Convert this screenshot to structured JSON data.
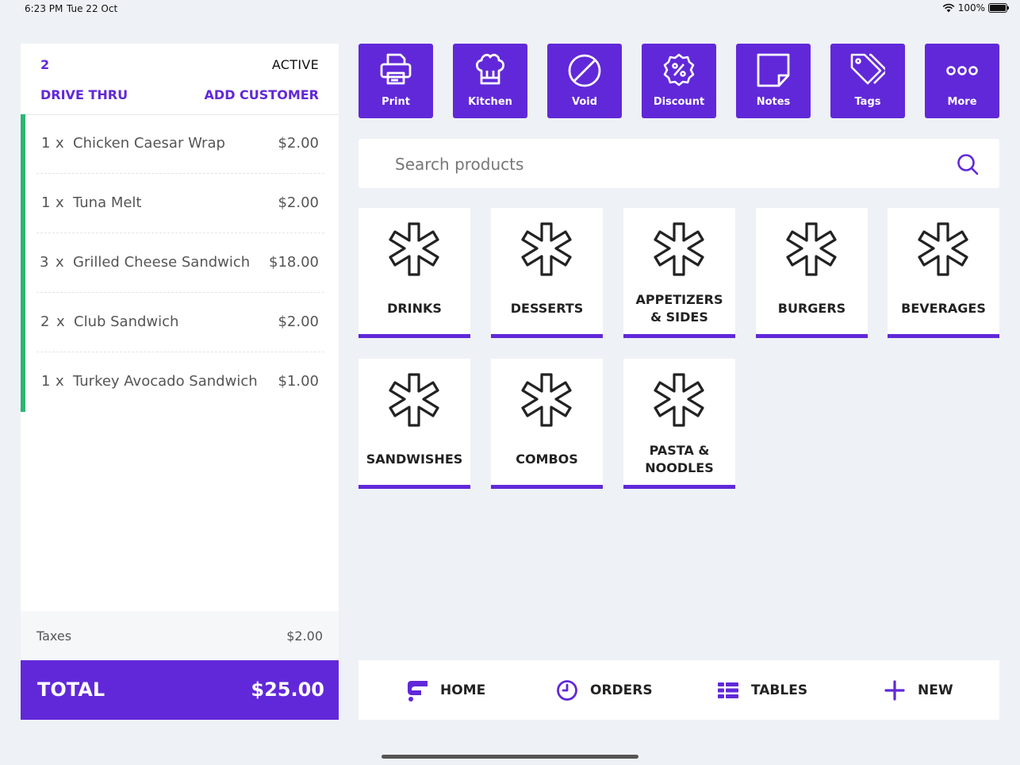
{
  "status_bar": {
    "time": "6:23 PM",
    "date": "Tue 22 Oct",
    "battery": "100%",
    "battery_level": 1.0
  },
  "order": {
    "number": "2",
    "status": "ACTIVE",
    "type": "DRIVE THRU",
    "add_customer_label": "ADD CUSTOMER",
    "items": [
      {
        "qty": "1",
        "x": "x",
        "name": "Chicken Caesar Wrap",
        "price": "$2.00"
      },
      {
        "qty": "1",
        "x": "x",
        "name": "Tuna Melt",
        "price": "$2.00"
      },
      {
        "qty": "3",
        "x": "x",
        "name": "Grilled Cheese Sandwich",
        "price": "$18.00"
      },
      {
        "qty": "2",
        "x": "x",
        "name": "Club Sandwich",
        "price": "$2.00"
      },
      {
        "qty": "1",
        "x": "x",
        "name": "Turkey Avocado Sandwich",
        "price": "$1.00"
      }
    ],
    "taxes_label": "Taxes",
    "taxes_value": "$2.00",
    "total_label": "TOTAL",
    "total_value": "$25.00"
  },
  "actions": [
    {
      "label": "Print",
      "icon": "printer-icon"
    },
    {
      "label": "Kitchen",
      "icon": "chef-hat-icon"
    },
    {
      "label": "Void",
      "icon": "void-icon"
    },
    {
      "label": "Discount",
      "icon": "discount-icon"
    },
    {
      "label": "Notes",
      "icon": "note-icon"
    },
    {
      "label": "Tags",
      "icon": "tags-icon"
    },
    {
      "label": "More",
      "icon": "more-icon"
    }
  ],
  "search": {
    "placeholder": "Search products",
    "icon": "search-icon"
  },
  "categories": [
    {
      "label": "DRINKS",
      "icon": "asterisk-icon"
    },
    {
      "label": "DESSERTS",
      "icon": "asterisk-icon"
    },
    {
      "label": "APPETIZERS & SIDES",
      "icon": "asterisk-icon"
    },
    {
      "label": "BURGERS",
      "icon": "asterisk-icon"
    },
    {
      "label": "BEVERAGES",
      "icon": "asterisk-icon"
    },
    {
      "label": "SANDWISHES",
      "icon": "asterisk-icon"
    },
    {
      "label": "COMBOS",
      "icon": "asterisk-icon"
    },
    {
      "label": "PASTA & NOODLES",
      "icon": "asterisk-icon"
    }
  ],
  "nav": [
    {
      "label": "HOME",
      "icon": "home-logo-icon"
    },
    {
      "label": "ORDERS",
      "icon": "clock-icon"
    },
    {
      "label": "TABLES",
      "icon": "tables-icon"
    },
    {
      "label": "NEW",
      "icon": "plus-icon"
    }
  ],
  "colors": {
    "accent": "#6128d9",
    "item_marker": "#2bb673",
    "background": "#eef1f5"
  }
}
